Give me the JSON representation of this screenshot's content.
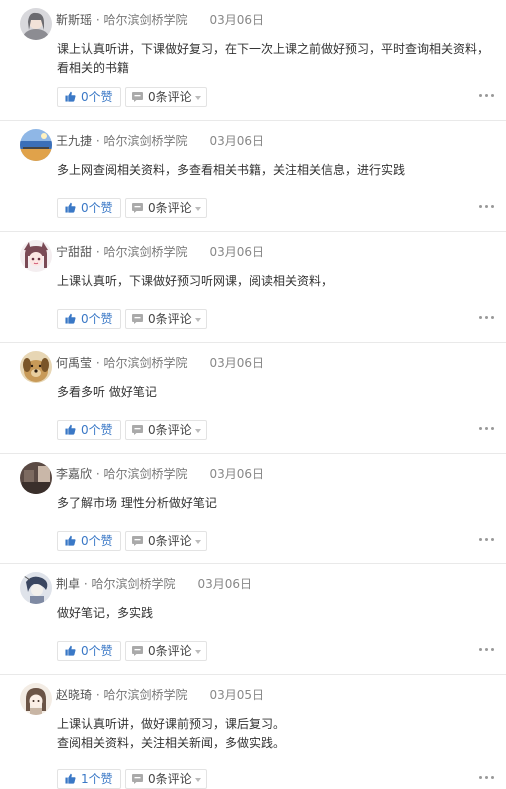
{
  "posts": [
    {
      "author": "靳斯瑶",
      "school": "哈尔滨剑桥学院",
      "date": "03月06日",
      "lines": [
        "课上认真听讲，下课做好复习，在下一次上课之前做好预习，平时查询相关资料，",
        "看相关的书籍"
      ],
      "likes": "0个赞",
      "comments": "0条评论",
      "avatar": {
        "icon": "woman-portrait-icon",
        "colors": [
          "#d8d8dc",
          "#8c8c92"
        ]
      }
    },
    {
      "author": "王九捷",
      "school": "哈尔滨剑桥学院",
      "date": "03月06日",
      "lines": [
        "多上网查阅相关资料，多查看相关书籍，关注相关信息，进行实践"
      ],
      "likes": "0个赞",
      "comments": "0条评论",
      "avatar": {
        "icon": "landscape-icon",
        "colors": [
          "#3b6fb8",
          "#e0a24a"
        ]
      }
    },
    {
      "author": "宁甜甜",
      "school": "哈尔滨剑桥学院",
      "date": "03月06日",
      "lines": [
        "上课认真听，下课做好预习听网课，阅读相关资料，"
      ],
      "likes": "0个赞",
      "comments": "0条评论",
      "avatar": {
        "icon": "anime-girl-icon",
        "colors": [
          "#f4eef0",
          "#7a4a55"
        ]
      }
    },
    {
      "author": "何禹莹",
      "school": "哈尔滨剑桥学院",
      "date": "03月06日",
      "lines": [
        "多看多听 做好笔记"
      ],
      "likes": "0个赞",
      "comments": "0条评论",
      "avatar": {
        "icon": "dog-icon",
        "colors": [
          "#c89a58",
          "#7a5528"
        ]
      }
    },
    {
      "author": "李嘉欣",
      "school": "哈尔滨剑桥学院",
      "date": "03月06日",
      "lines": [
        "多了解市场 理性分析做好笔记"
      ],
      "likes": "0个赞",
      "comments": "0条评论",
      "avatar": {
        "icon": "room-photo-icon",
        "colors": [
          "#5a4a44",
          "#c9b7a8"
        ]
      }
    },
    {
      "author": "荆卓",
      "school": "哈尔滨剑桥学院",
      "date": "03月06日",
      "lines": [
        "做好笔记，多实践"
      ],
      "likes": "0个赞",
      "comments": "0条评论",
      "avatar": {
        "icon": "sketch-portrait-icon",
        "colors": [
          "#dfe3ea",
          "#3a4660"
        ]
      }
    },
    {
      "author": "赵晓琦",
      "school": "哈尔滨剑桥学院",
      "date": "03月05日",
      "lines": [
        "上课认真听讲，做好课前预习，课后复习。",
        "查阅相关资料，关注相关新闻，多做实践。"
      ],
      "likes": "1个赞",
      "comments": "0条评论",
      "avatar": {
        "icon": "cartoon-girl-icon",
        "colors": [
          "#f3ece4",
          "#6b5446"
        ]
      }
    }
  ],
  "separator": " · ",
  "colors": {
    "like": "#3a78c6",
    "border": "#e3e3e3",
    "meta": "#777777",
    "divider": "#e9e9e9"
  }
}
